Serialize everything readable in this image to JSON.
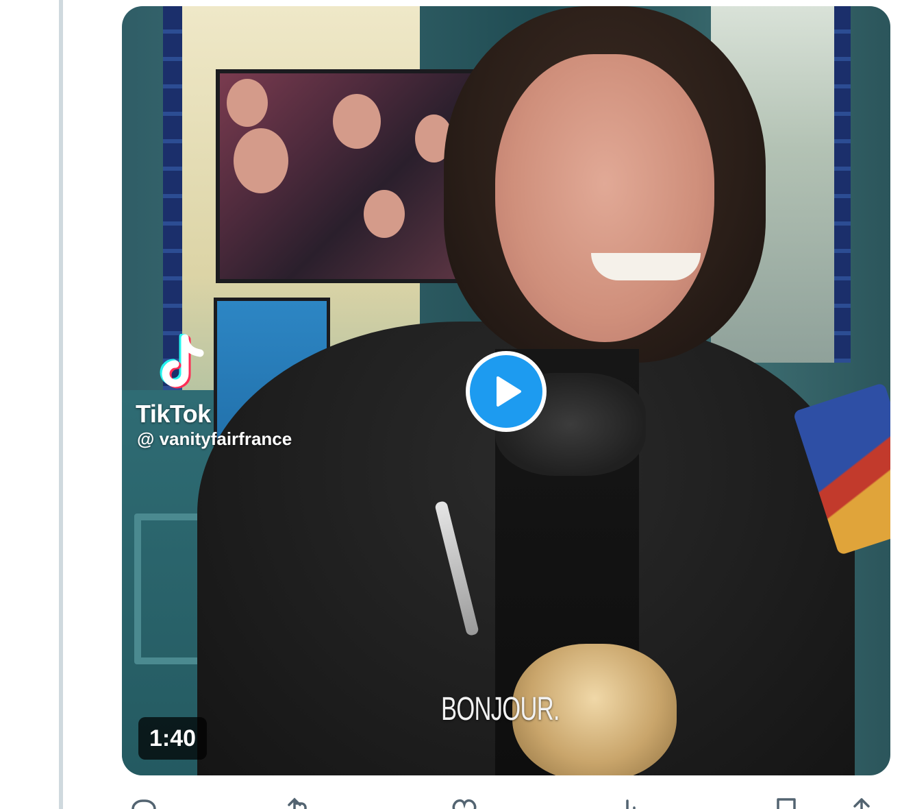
{
  "media": {
    "type": "video",
    "watermark": {
      "brand": "TikTok",
      "handle": "@ vanityfairfrance"
    },
    "caption": "BONJOUR.",
    "duration": "1:40",
    "play_icon": "play-icon"
  },
  "actions": [
    {
      "name": "reply",
      "icon": "reply-icon"
    },
    {
      "name": "retweet",
      "icon": "retweet-icon"
    },
    {
      "name": "like",
      "icon": "like-icon"
    },
    {
      "name": "views",
      "icon": "views-icon"
    },
    {
      "name": "bookmark",
      "icon": "bookmark-icon"
    },
    {
      "name": "share",
      "icon": "share-icon"
    }
  ],
  "colors": {
    "accent": "#1d9bf0",
    "thread_line": "#cfd9de",
    "action_gray": "#536471"
  }
}
